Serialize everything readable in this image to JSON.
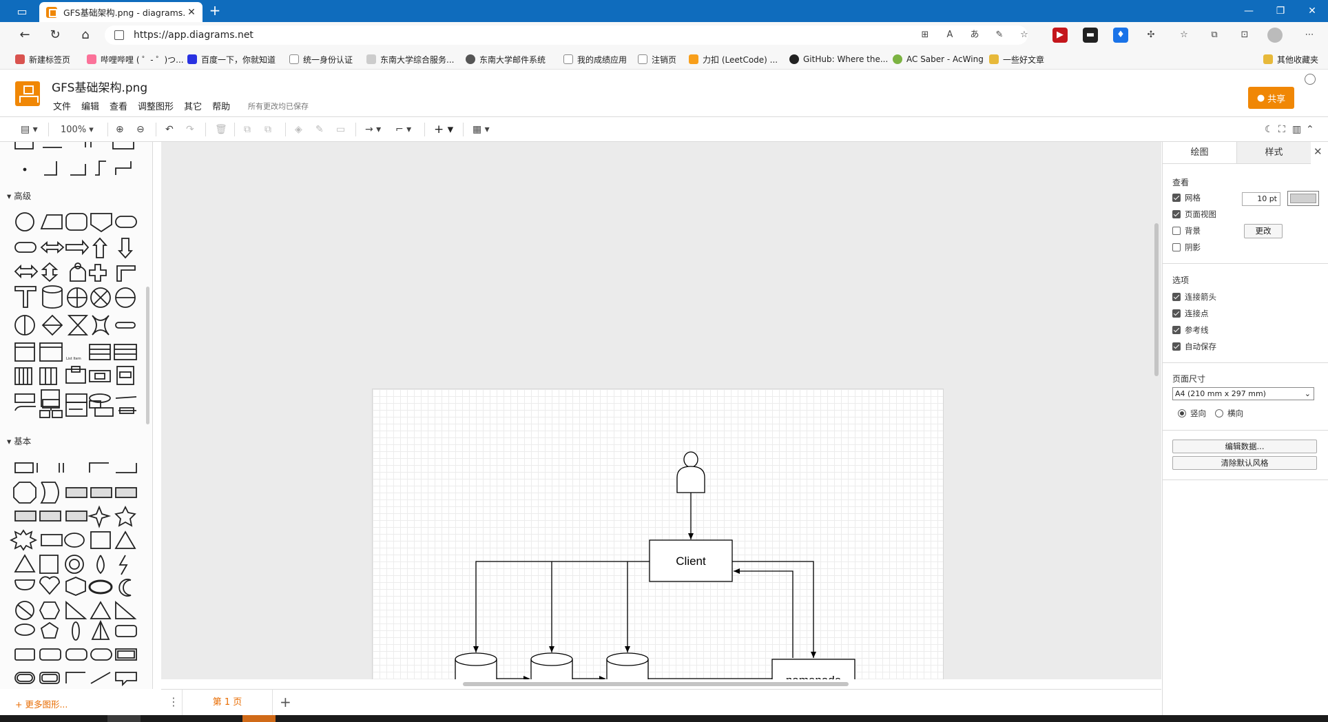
{
  "browser": {
    "tab_title": "GFS基础架构.png - diagrams.net",
    "url": "https://app.diagrams.net",
    "bookmarks": [
      {
        "label": "新建标签页",
        "color": "#d9534f"
      },
      {
        "label": "哔哩哔哩 ( ゜- ゜)つ...",
        "color": "#fb7299"
      },
      {
        "label": "百度一下，你就知道",
        "color": "#2932e1"
      },
      {
        "label": "统一身份认证",
        "color": "#888888"
      },
      {
        "label": "东南大学综合服务...",
        "color": "#888888"
      },
      {
        "label": "东南大学邮件系统",
        "color": "#555555"
      },
      {
        "label": "我的成绩应用",
        "color": "#888888"
      },
      {
        "label": "注销页",
        "color": "#888888"
      },
      {
        "label": "力扣 (LeetCode) ...",
        "color": "#f89f1b"
      },
      {
        "label": "GitHub: Where the...",
        "color": "#222222"
      },
      {
        "label": "AC Saber - AcWing",
        "color": "#7cb342"
      },
      {
        "label": "一些好文章",
        "color": "#e7b93a"
      }
    ],
    "other_bookmarks": "其他收藏夹"
  },
  "app": {
    "doc_title": "GFS基础架构.png",
    "menus": [
      "文件",
      "编辑",
      "查看",
      "调整图形",
      "其它",
      "帮助"
    ],
    "saved_status": "所有更改均已保存",
    "share_label": "共享",
    "accent": "#f08705"
  },
  "toolbar": {
    "zoom": "100%"
  },
  "left_panel": {
    "section_advanced": "高级",
    "section_basic": "基本",
    "more_shapes": "+ 更多图形..."
  },
  "diagram": {
    "client_label": "Client",
    "namenode_label": "namenode"
  },
  "pages": {
    "current_tab": "第 1 页"
  },
  "right_panel": {
    "tab_diagram": "绘图",
    "tab_style": "样式",
    "view_header": "查看",
    "grid_label": "网格",
    "grid_size": "10 pt",
    "page_view_label": "页面视图",
    "background_label": "背景",
    "change_button": "更改",
    "shadow_label": "阴影",
    "options_header": "选项",
    "connection_arrows": "连接箭头",
    "connection_points": "连接点",
    "guides": "参考线",
    "autosave": "自动保存",
    "page_size_header": "页面尺寸",
    "page_size_value": "A4 (210 mm x 297 mm)",
    "portrait": "竖向",
    "landscape": "横向",
    "edit_data_button": "编辑数据...",
    "clear_style_button": "清除默认风格"
  }
}
